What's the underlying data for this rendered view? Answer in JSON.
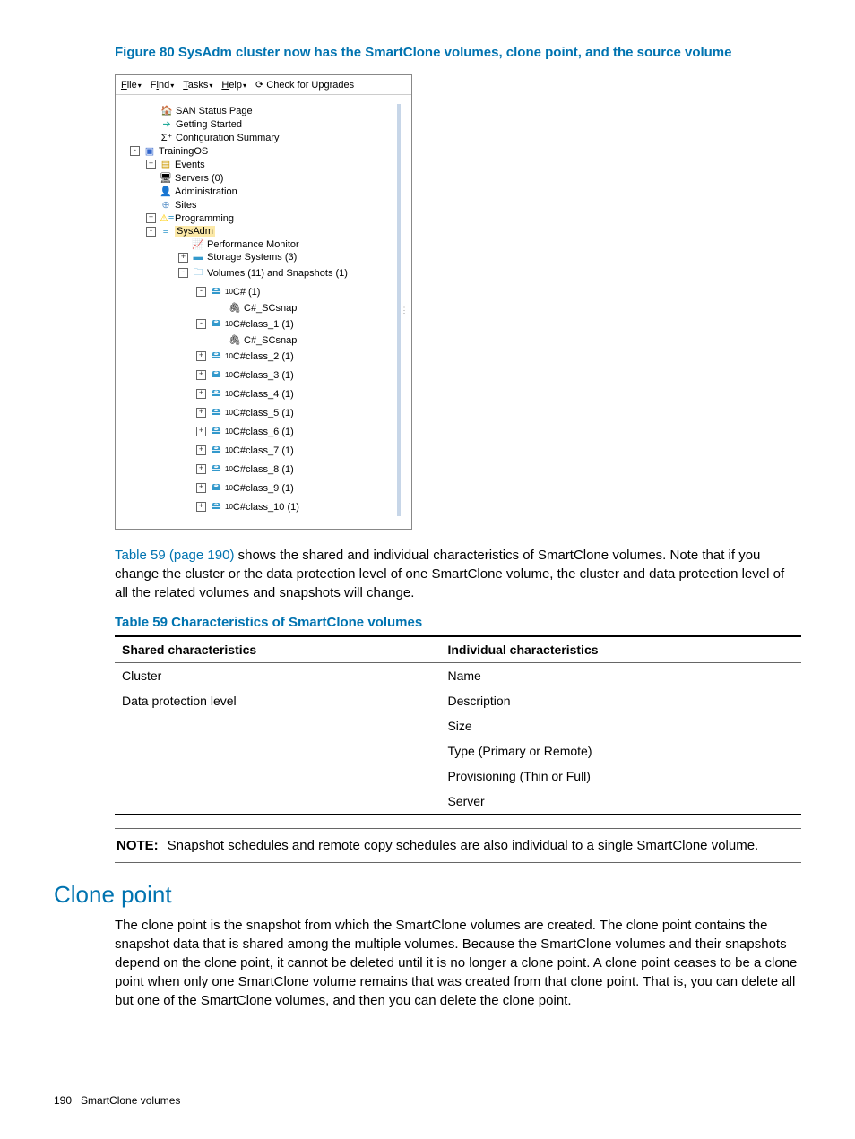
{
  "figure_title": "Figure 80 SysAdm cluster now has the SmartClone volumes, clone point, and the source volume",
  "menu": {
    "file": "File",
    "find": "Find",
    "tasks": "Tasks",
    "help": "Help",
    "check": "Check for Upgrades"
  },
  "tree": {
    "san": "SAN Status Page",
    "getting": "Getting Started",
    "config": "Configuration Summary",
    "training": "TrainingOS",
    "events": "Events",
    "servers": "Servers (0)",
    "admin": "Administration",
    "sites": "Sites",
    "programming": "Programming",
    "sysadm": "SysAdm",
    "perfmon": "Performance Monitor",
    "storage": "Storage Systems (3)",
    "volumes": "Volumes (11) and Snapshots (1)",
    "c_sharp": "C# (1)",
    "c_scsnap1": "C#_SCsnap",
    "cclass1": "C#class_1 (1)",
    "c_scsnap2": "C#_SCsnap",
    "cclass2": "C#class_2 (1)",
    "cclass3": "C#class_3 (1)",
    "cclass4": "C#class_4 (1)",
    "cclass5": "C#class_5 (1)",
    "cclass6": "C#class_6 (1)",
    "cclass7": "C#class_7 (1)",
    "cclass8": "C#class_8 (1)",
    "cclass9": "C#class_9 (1)",
    "cclass10": "C#class_10 (1)"
  },
  "para1_link": "Table 59 (page 190)",
  "para1_rest": " shows the shared and individual characteristics of SmartClone volumes. Note that if you change the cluster or the data protection level of one SmartClone volume, the cluster and data protection level of all the related volumes and snapshots will change.",
  "table_title": "Table 59 Characteristics of SmartClone volumes",
  "table": {
    "head_shared": "Shared characteristics",
    "head_indiv": "Individual characteristics",
    "shared": [
      "Cluster",
      "Data protection level"
    ],
    "indiv": [
      "Name",
      "Description",
      "Size",
      "Type (Primary or Remote)",
      "Provisioning (Thin or Full)",
      "Server"
    ]
  },
  "note_label": "NOTE:",
  "note_text": "Snapshot schedules and remote copy schedules are also individual to a single SmartClone volume.",
  "section_head": "Clone point",
  "section_body": "The clone point is the snapshot from which the SmartClone volumes are created. The clone point contains the snapshot data that is shared among the multiple volumes. Because the SmartClone volumes and their snapshots depend on the clone point, it cannot be deleted until it is no longer a clone point. A clone point ceases to be a clone point when only one SmartClone volume remains that was created from that clone point. That is, you can delete all but one of the SmartClone volumes, and then you can delete the clone point.",
  "footer_page": "190",
  "footer_title": "SmartClone volumes"
}
